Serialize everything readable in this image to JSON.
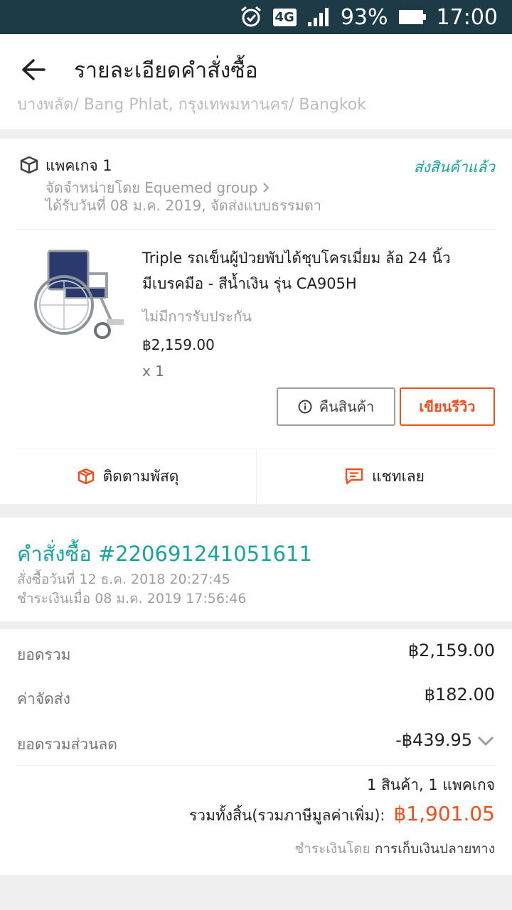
{
  "status_bar": {
    "battery": "93%",
    "time": "17:00",
    "network": "4G"
  },
  "header": {
    "title": "รายละเอียดคำสั่งซื้อ"
  },
  "address_cut": "บางพลัด/ Bang Phlat, กรุงเทพมหานคร/ Bangkok",
  "package": {
    "title": "แพคเกจ 1",
    "status": "ส่งสินค้าแล้ว",
    "seller": "จัดจำหน่ายโดย Equemed group",
    "delivery": "ได้รับวันที่ 08 ม.ค. 2019, จัดส่งแบบธรรมดา"
  },
  "product": {
    "name_line1": "Triple รถเข็นผู้ป่วยพับได้ชุบโครเมี่ยม ล้อ 24 นิ้ว",
    "name_line2": "มีเบรคมือ - สีน้ำเงิน รุ่น CA905H",
    "warranty": "ไม่มีการรับประกัน",
    "price": "฿2,159.00",
    "qty": "x 1"
  },
  "buttons": {
    "return": "คืนสินค้า",
    "review": "เขียนรีวิว"
  },
  "actions": {
    "track": "ติดตามพัสดุ",
    "chat": "แชทเลย"
  },
  "order": {
    "number": "คำสั่งซื้อ #220691241051611",
    "placed": "สั่งซื้อวันที่ 12 ธ.ค. 2018  20:27:45",
    "paid": "ชำระเงินเมื่อ 08 ม.ค. 2019  17:56:46"
  },
  "summary": {
    "subtotal_label": "ยอดรวม",
    "subtotal": "฿2,159.00",
    "shipping_label": "ค่าจัดส่ง",
    "shipping": "฿182.00",
    "discount_label": "ยอดรวมส่วนลด",
    "discount": "-฿439.95",
    "count": "1 สินค้า, 1 แพคเกจ",
    "total_label": "รวมทั้งสิ้น(รวมภาษีมูลค่าเพิ่ม):",
    "total": "฿1,901.05",
    "pay_label": "ชำระเงินโดย",
    "pay_method": "การเก็บเงินปลายทาง"
  },
  "colors": {
    "accent_teal": "#1aa39a",
    "accent_orange": "#f24e1e",
    "status_bar": "#1d3b46"
  }
}
